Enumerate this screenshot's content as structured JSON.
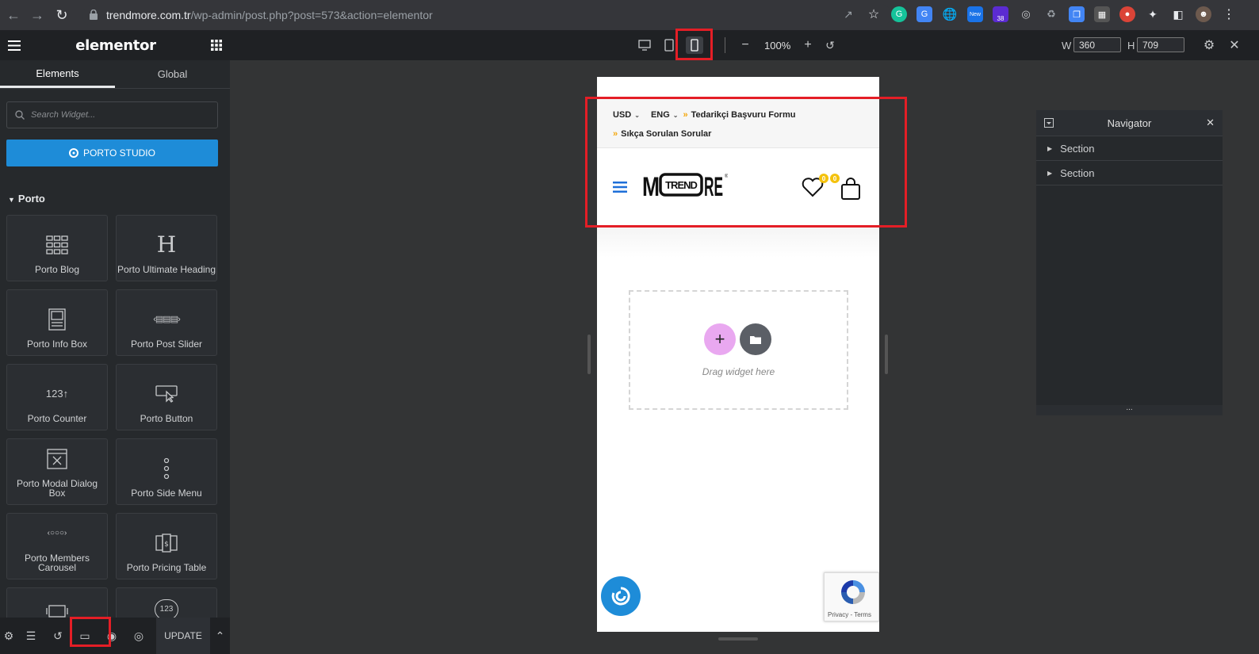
{
  "browser": {
    "url_domain": "trendmore.com.tr",
    "url_path": "/wp-admin/post.php?post=573&action=elementor",
    "ext_new_label": "New",
    "ext_badge_count": "38"
  },
  "panel": {
    "brand": "elementor",
    "tabs": [
      {
        "label": "Elements"
      },
      {
        "label": "Global"
      }
    ],
    "search_placeholder": "Search Widget...",
    "studio_button": "PORTO STUDIO",
    "section_title": "Porto",
    "widgets": [
      {
        "label": "Porto Blog",
        "icon": "blog-grid-icon"
      },
      {
        "label": "Porto Ultimate Heading",
        "icon": "heading-icon"
      },
      {
        "label": "Porto Info Box",
        "icon": "info-box-icon"
      },
      {
        "label": "Porto Post Slider",
        "icon": "post-slider-icon"
      },
      {
        "label": "Porto Counter",
        "icon": "counter-icon"
      },
      {
        "label": "Porto Button",
        "icon": "button-cursor-icon"
      },
      {
        "label": "Porto Modal Dialog Box",
        "icon": "modal-icon"
      },
      {
        "label": "Porto Side Menu",
        "icon": "side-menu-icon"
      },
      {
        "label": "Porto Members Carousel",
        "icon": "carousel-icon"
      },
      {
        "label": "Porto Pricing Table",
        "icon": "pricing-table-icon"
      },
      {
        "label": "",
        "icon": "slider-icon"
      },
      {
        "label": "",
        "icon": "countdown-icon"
      }
    ],
    "update_button": "UPDATE"
  },
  "responsive_bar": {
    "zoom": "100%",
    "width_label": "W",
    "width_value": "360",
    "height_label": "H",
    "height_value": "709",
    "active_device": "mobile"
  },
  "preview": {
    "currency": "USD",
    "language": "ENG",
    "link_supplier": "Tedarikçi Başvuru Formu",
    "link_faq": "Sıkça Sorulan Sorular",
    "wishlist_count": "0",
    "cart_count": "0",
    "logo_text": "TREND",
    "dropzone_text": "Drag widget here",
    "recaptcha_text": "Privacy - Terms"
  },
  "navigator": {
    "title": "Navigator",
    "items": [
      {
        "label": "Section"
      },
      {
        "label": "Section"
      }
    ],
    "footer": "..."
  },
  "colors": {
    "accent": "#1e8cd8",
    "highlight": "#e41e26",
    "badge": "#f4c20d"
  }
}
